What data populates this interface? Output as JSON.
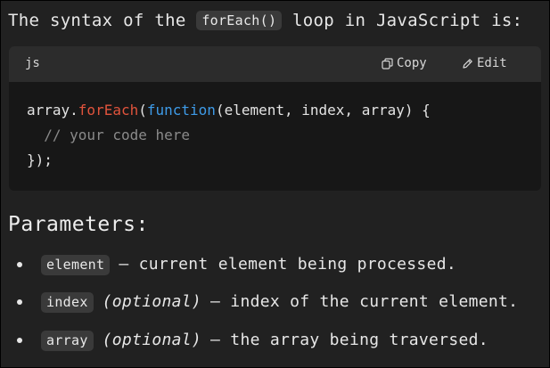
{
  "intro": {
    "before": "The syntax of the ",
    "code": "forEach()",
    "after": " loop in JavaScript is:"
  },
  "code_block": {
    "language": "js",
    "copy_label": "Copy",
    "edit_label": "Edit",
    "line1": {
      "obj": "array.",
      "method": "forEach",
      "paren": "(",
      "keyword": "function",
      "args": "(element, index, array) {"
    },
    "line2": "  // your code here",
    "line3": "});"
  },
  "params": {
    "title": "Parameters:",
    "items": [
      {
        "code": "element",
        "optional": "",
        "desc": "– current element being processed."
      },
      {
        "code": "index",
        "optional": "(optional)",
        "desc": "– index of the current element."
      },
      {
        "code": "array",
        "optional": "(optional)",
        "desc": "– the array being traversed."
      }
    ]
  },
  "colors": {
    "background": "#212121",
    "code_bg": "#171717",
    "code_header": "#2c2c2c",
    "method": "#e0533c",
    "keyword": "#3e9be8",
    "comment": "#8a8a8a"
  }
}
